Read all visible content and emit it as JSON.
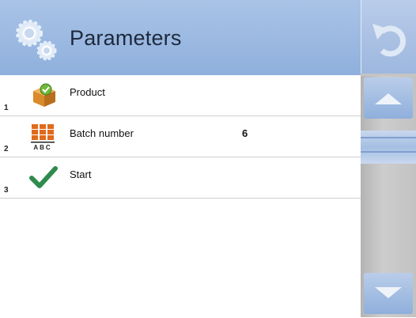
{
  "header": {
    "title": "Parameters",
    "icon": "gears-icon"
  },
  "items": [
    {
      "number": "1",
      "label": "Product",
      "value": "",
      "icon": "product-box-icon"
    },
    {
      "number": "2",
      "label": "Batch number",
      "value": "6",
      "icon": "batch-number-icon",
      "icon_caption": "ABC"
    },
    {
      "number": "3",
      "label": "Start",
      "value": "",
      "icon": "checkmark-icon"
    }
  ],
  "sidebar": {
    "back_icon": "undo-arrow-icon",
    "up_icon": "scroll-up-icon",
    "down_icon": "scroll-down-icon"
  },
  "colors": {
    "header": "#a9c3e6",
    "accent_blue": "#8fb0dd",
    "check_green": "#2e8b4e",
    "batch_orange": "#e06a1c",
    "product_green": "#6fb83a"
  }
}
